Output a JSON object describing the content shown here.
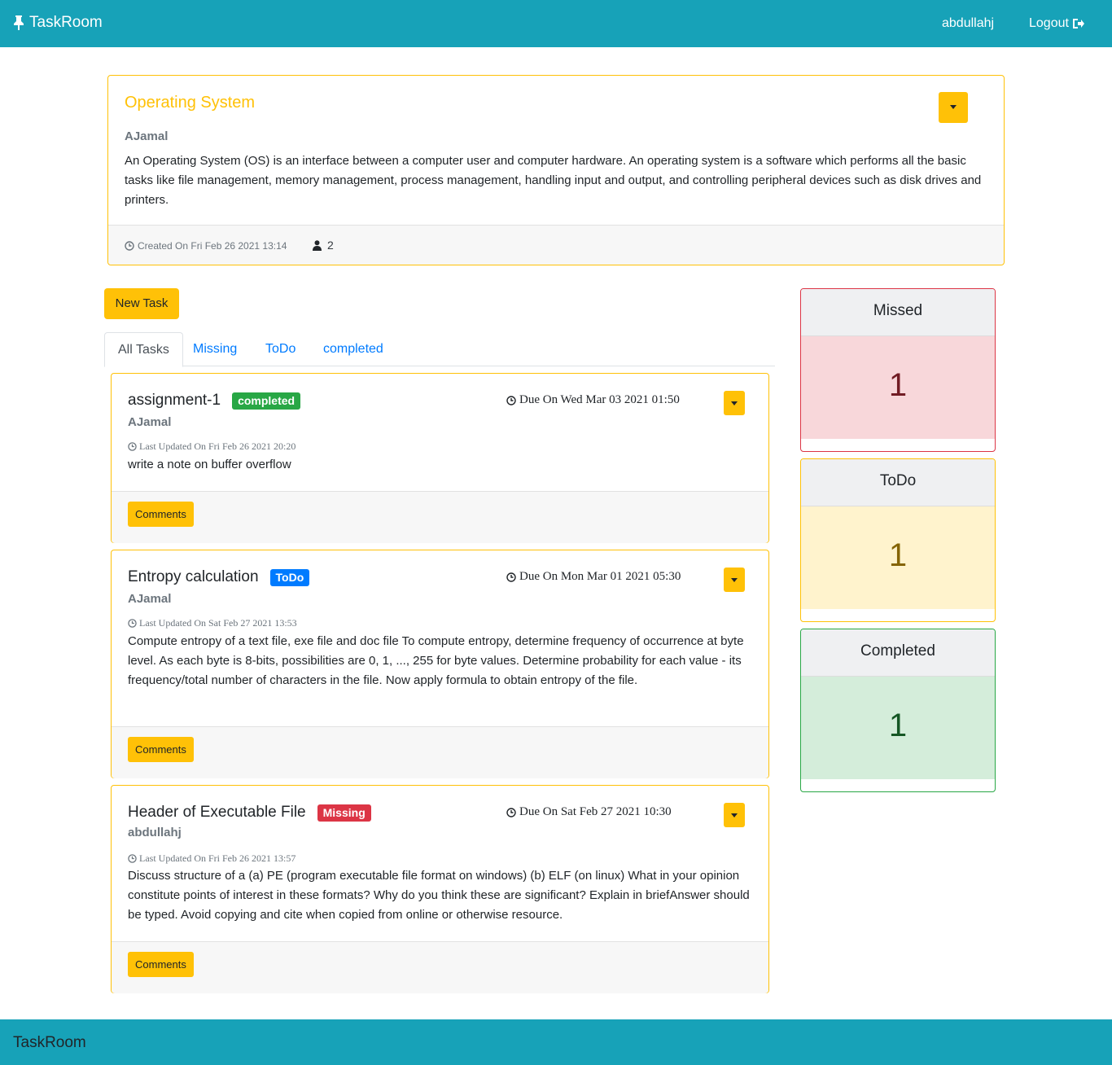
{
  "nav": {
    "brand": "TaskRoom",
    "user": "abdullahj",
    "logout": "Logout"
  },
  "classroom": {
    "title": "Operating System",
    "author": "AJamal",
    "description": "An Operating System (OS) is an interface between a computer user and computer hardware. An operating system is a software which performs all the basic tasks like file management, memory management, process management, handling input and output, and controlling peripheral devices such as disk drives and printers.",
    "created": "Created On Fri Feb 26 2021 13:14",
    "members": "2"
  },
  "new_task_label": "New Task",
  "tabs": [
    {
      "label": "All Tasks"
    },
    {
      "label": "Missing"
    },
    {
      "label": "ToDo"
    },
    {
      "label": "completed"
    }
  ],
  "tasks": [
    {
      "title": "assignment-1",
      "status": "completed",
      "due": "Due On Wed Mar 03 2021 01:50",
      "author": "AJamal",
      "updated": "Last Updated On Fri Feb 26 2021 20:20",
      "description": "write a note on buffer overflow",
      "comments_label": "Comments"
    },
    {
      "title": "Entropy calculation",
      "status": "ToDo",
      "due": "Due On Mon Mar 01 2021 05:30",
      "author": "AJamal",
      "updated": "Last Updated On Sat Feb 27 2021 13:53",
      "description": "Compute entropy of a text file, exe file and doc file To compute entropy, determine frequency of occurrence at byte level. As each byte is 8-bits, possibilities are 0, 1, ..., 255 for byte values. Determine probability for each value - its frequency/total number of characters in the file. Now apply formula to obtain entropy of the file.",
      "comments_label": "Comments"
    },
    {
      "title": "Header of Executable File",
      "status": "Missing",
      "due": "Due On Sat Feb 27 2021 10:30",
      "author": "abdullahj",
      "updated": "Last Updated On Fri Feb 26 2021 13:57",
      "description": "Discuss structure of a (a) PE (program executable file format on windows) (b) ELF (on linux) What in your opinion constitute points of interest in these formats? Why do you think these are significant? Explain in briefAnswer should be typed. Avoid copying and cite when copied from online or otherwise resource.",
      "comments_label": "Comments"
    }
  ],
  "stats": {
    "missed": {
      "label": "Missed",
      "count": "1",
      "color": "#dc3545"
    },
    "todo": {
      "label": "ToDo",
      "count": "1",
      "color": "#ffc107"
    },
    "completed": {
      "label": "Completed",
      "count": "1",
      "color": "#28a745"
    }
  },
  "footer": {
    "brand": "TaskRoom"
  },
  "colors": {
    "primary_bar": "#17a2b8",
    "warning": "#ffc107",
    "link": "#007bff"
  },
  "icons": [
    "thumbtack-icon",
    "sign-out-icon",
    "clock-icon",
    "user-icon",
    "caret-down-icon"
  ]
}
